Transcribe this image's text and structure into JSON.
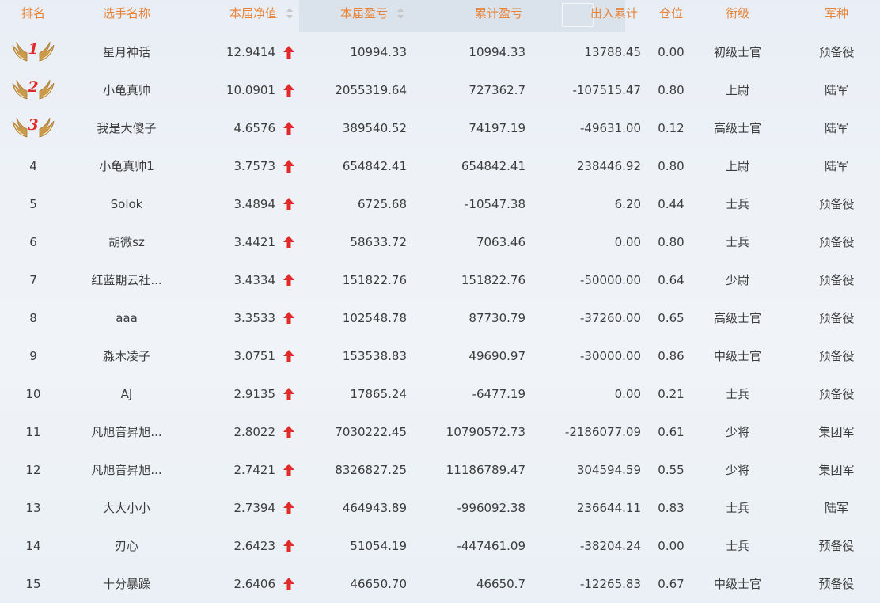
{
  "columns": {
    "rank": "排名",
    "name": "选手名称",
    "net_value": "本届净值",
    "current_pnl": "本届盈亏",
    "total_pnl": "累计盈亏",
    "in_out_total": "出入累计",
    "position": "仓位",
    "title": "衔级",
    "branch": "军种"
  },
  "colors": {
    "header_text": "#e8843a",
    "up_arrow": "#e02b2b",
    "medal_number": "#e02b2b",
    "wing": "#c99a4b"
  },
  "rows": [
    {
      "rank": "1",
      "medal": true,
      "name": "星月神话",
      "net_value": "12.9414",
      "current_pnl": "10994.33",
      "total_pnl": "10994.33",
      "in_out_total": "13788.45",
      "position": "0.00",
      "title": "初级士官",
      "branch": "预备役"
    },
    {
      "rank": "2",
      "medal": true,
      "name": "小龟真帅",
      "net_value": "10.0901",
      "current_pnl": "2055319.64",
      "total_pnl": "727362.7",
      "in_out_total": "-107515.47",
      "position": "0.80",
      "title": "上尉",
      "branch": "陆军"
    },
    {
      "rank": "3",
      "medal": true,
      "name": "我是大傻子",
      "net_value": "4.6576",
      "current_pnl": "389540.52",
      "total_pnl": "74197.19",
      "in_out_total": "-49631.00",
      "position": "0.12",
      "title": "高级士官",
      "branch": "陆军"
    },
    {
      "rank": "4",
      "name": "小龟真帅1",
      "net_value": "3.7573",
      "current_pnl": "654842.41",
      "total_pnl": "654842.41",
      "in_out_total": "238446.92",
      "position": "0.80",
      "title": "上尉",
      "branch": "陆军"
    },
    {
      "rank": "5",
      "name": "Solok",
      "net_value": "3.4894",
      "current_pnl": "6725.68",
      "total_pnl": "-10547.38",
      "in_out_total": "6.20",
      "position": "0.44",
      "title": "士兵",
      "branch": "预备役"
    },
    {
      "rank": "6",
      "name": "胡微sz",
      "net_value": "3.4421",
      "current_pnl": "58633.72",
      "total_pnl": "7063.46",
      "in_out_total": "0.00",
      "position": "0.80",
      "title": "士兵",
      "branch": "预备役"
    },
    {
      "rank": "7",
      "name": "红蓝期云社...",
      "net_value": "3.4334",
      "current_pnl": "151822.76",
      "total_pnl": "151822.76",
      "in_out_total": "-50000.00",
      "position": "0.64",
      "title": "少尉",
      "branch": "预备役"
    },
    {
      "rank": "8",
      "name": "aaa",
      "net_value": "3.3533",
      "current_pnl": "102548.78",
      "total_pnl": "87730.79",
      "in_out_total": "-37260.00",
      "position": "0.65",
      "title": "高级士官",
      "branch": "预备役"
    },
    {
      "rank": "9",
      "name": "淼木凌子",
      "net_value": "3.0751",
      "current_pnl": "153538.83",
      "total_pnl": "49690.97",
      "in_out_total": "-30000.00",
      "position": "0.86",
      "title": "中级士官",
      "branch": "预备役"
    },
    {
      "rank": "10",
      "name": "AJ",
      "net_value": "2.9135",
      "current_pnl": "17865.24",
      "total_pnl": "-6477.19",
      "in_out_total": "0.00",
      "position": "0.21",
      "title": "士兵",
      "branch": "预备役"
    },
    {
      "rank": "11",
      "name": "凡旭音昇旭...",
      "net_value": "2.8022",
      "current_pnl": "7030222.45",
      "total_pnl": "10790572.73",
      "in_out_total": "-2186077.09",
      "position": "0.61",
      "title": "少将",
      "branch": "集团军"
    },
    {
      "rank": "12",
      "name": "凡旭音昇旭...",
      "net_value": "2.7421",
      "current_pnl": "8326827.25",
      "total_pnl": "11186789.47",
      "in_out_total": "304594.59",
      "position": "0.55",
      "title": "少将",
      "branch": "集团军"
    },
    {
      "rank": "13",
      "name": "大大小小",
      "net_value": "2.7394",
      "current_pnl": "464943.89",
      "total_pnl": "-996092.38",
      "in_out_total": "236644.11",
      "position": "0.83",
      "title": "士兵",
      "branch": "陆军"
    },
    {
      "rank": "14",
      "name": "刃心",
      "net_value": "2.6423",
      "current_pnl": "51054.19",
      "total_pnl": "-447461.09",
      "in_out_total": "-38204.24",
      "position": "0.00",
      "title": "士兵",
      "branch": "预备役"
    },
    {
      "rank": "15",
      "name": "十分暴躁",
      "net_value": "2.6406",
      "current_pnl": "46650.70",
      "total_pnl": "46650.7",
      "in_out_total": "-12265.83",
      "position": "0.67",
      "title": "中级士官",
      "branch": "预备役"
    }
  ]
}
